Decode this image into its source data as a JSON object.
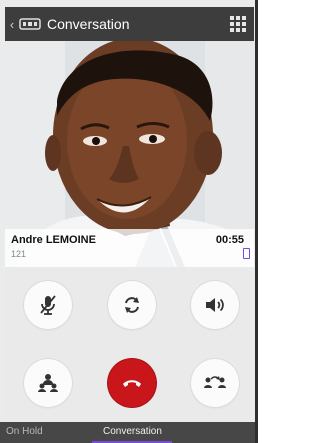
{
  "header": {
    "title": "Conversation",
    "back_icon": "chevron-left-icon",
    "app_icon": "linphone-icon",
    "menu_icon": "dialpad-grid-icon"
  },
  "caller": {
    "name": "Andre LEMOINE",
    "number": "121",
    "duration": "00:55"
  },
  "controls": {
    "mute_icon": "microphone-off-icon",
    "switch_camera_icon": "switch-camera-icon",
    "speaker_icon": "speaker-icon",
    "conference_icon": "conference-icon",
    "hangup_icon": "hangup-icon",
    "transfer_icon": "transfer-icon",
    "hangup_color": "#c8161b"
  },
  "tabs": {
    "on_hold": "On Hold",
    "conversation": "Conversation",
    "active": "conversation",
    "accent_color": "#7a4bd6"
  }
}
